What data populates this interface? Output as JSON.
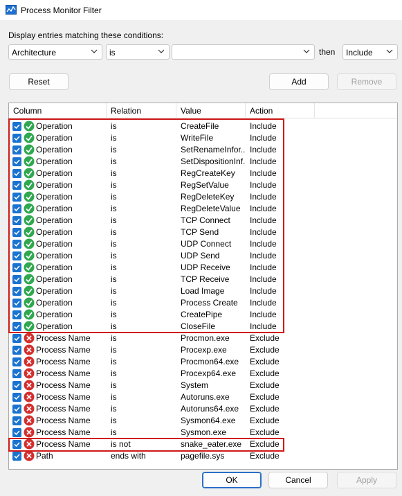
{
  "window": {
    "title": "Process Monitor Filter"
  },
  "caption": "Display entries matching these conditions:",
  "filter": {
    "column": "Architecture",
    "relation": "is",
    "value": "",
    "then_label": "then",
    "action": "Include"
  },
  "buttons": {
    "reset": "Reset",
    "add": "Add",
    "remove": "Remove",
    "ok": "OK",
    "cancel": "Cancel",
    "apply": "Apply"
  },
  "columns": [
    "Column",
    "Relation",
    "Value",
    "Action"
  ],
  "rows": [
    {
      "column": "Operation",
      "relation": "is",
      "value": "CreateFile",
      "action": "Include",
      "status": "include"
    },
    {
      "column": "Operation",
      "relation": "is",
      "value": "WriteFile",
      "action": "Include",
      "status": "include"
    },
    {
      "column": "Operation",
      "relation": "is",
      "value": "SetRenameInfor...",
      "action": "Include",
      "status": "include"
    },
    {
      "column": "Operation",
      "relation": "is",
      "value": "SetDispositionInf...",
      "action": "Include",
      "status": "include"
    },
    {
      "column": "Operation",
      "relation": "is",
      "value": "RegCreateKey",
      "action": "Include",
      "status": "include"
    },
    {
      "column": "Operation",
      "relation": "is",
      "value": "RegSetValue",
      "action": "Include",
      "status": "include"
    },
    {
      "column": "Operation",
      "relation": "is",
      "value": "RegDeleteKey",
      "action": "Include",
      "status": "include"
    },
    {
      "column": "Operation",
      "relation": "is",
      "value": "RegDeleteValue",
      "action": "Include",
      "status": "include"
    },
    {
      "column": "Operation",
      "relation": "is",
      "value": "TCP Connect",
      "action": "Include",
      "status": "include"
    },
    {
      "column": "Operation",
      "relation": "is",
      "value": "TCP Send",
      "action": "Include",
      "status": "include"
    },
    {
      "column": "Operation",
      "relation": "is",
      "value": "UDP Connect",
      "action": "Include",
      "status": "include"
    },
    {
      "column": "Operation",
      "relation": "is",
      "value": "UDP Send",
      "action": "Include",
      "status": "include"
    },
    {
      "column": "Operation",
      "relation": "is",
      "value": "UDP Receive",
      "action": "Include",
      "status": "include"
    },
    {
      "column": "Operation",
      "relation": "is",
      "value": "TCP Receive",
      "action": "Include",
      "status": "include"
    },
    {
      "column": "Operation",
      "relation": "is",
      "value": "Load Image",
      "action": "Include",
      "status": "include"
    },
    {
      "column": "Operation",
      "relation": "is",
      "value": "Process Create",
      "action": "Include",
      "status": "include"
    },
    {
      "column": "Operation",
      "relation": "is",
      "value": "CreatePipe",
      "action": "Include",
      "status": "include"
    },
    {
      "column": "Operation",
      "relation": "is",
      "value": "CloseFile",
      "action": "Include",
      "status": "include"
    },
    {
      "column": "Process Name",
      "relation": "is",
      "value": "Procmon.exe",
      "action": "Exclude",
      "status": "exclude"
    },
    {
      "column": "Process Name",
      "relation": "is",
      "value": "Procexp.exe",
      "action": "Exclude",
      "status": "exclude"
    },
    {
      "column": "Process Name",
      "relation": "is",
      "value": "Procmon64.exe",
      "action": "Exclude",
      "status": "exclude"
    },
    {
      "column": "Process Name",
      "relation": "is",
      "value": "Procexp64.exe",
      "action": "Exclude",
      "status": "exclude"
    },
    {
      "column": "Process Name",
      "relation": "is",
      "value": "System",
      "action": "Exclude",
      "status": "exclude"
    },
    {
      "column": "Process Name",
      "relation": "is",
      "value": "Autoruns.exe",
      "action": "Exclude",
      "status": "exclude"
    },
    {
      "column": "Process Name",
      "relation": "is",
      "value": "Autoruns64.exe",
      "action": "Exclude",
      "status": "exclude"
    },
    {
      "column": "Process Name",
      "relation": "is",
      "value": "Sysmon64.exe",
      "action": "Exclude",
      "status": "exclude"
    },
    {
      "column": "Process Name",
      "relation": "is",
      "value": "Sysmon.exe",
      "action": "Exclude",
      "status": "exclude"
    },
    {
      "column": "Process Name",
      "relation": "is not",
      "value": "snake_eater.exe",
      "action": "Exclude",
      "status": "exclude"
    },
    {
      "column": "Path",
      "relation": "ends with",
      "value": "pagefile.sys",
      "action": "Exclude",
      "status": "exclude"
    }
  ],
  "colors": {
    "include": "#2fa84f",
    "exclude": "#d32f2f",
    "checkbox": "#1a73d0",
    "highlight": "#d01818"
  }
}
